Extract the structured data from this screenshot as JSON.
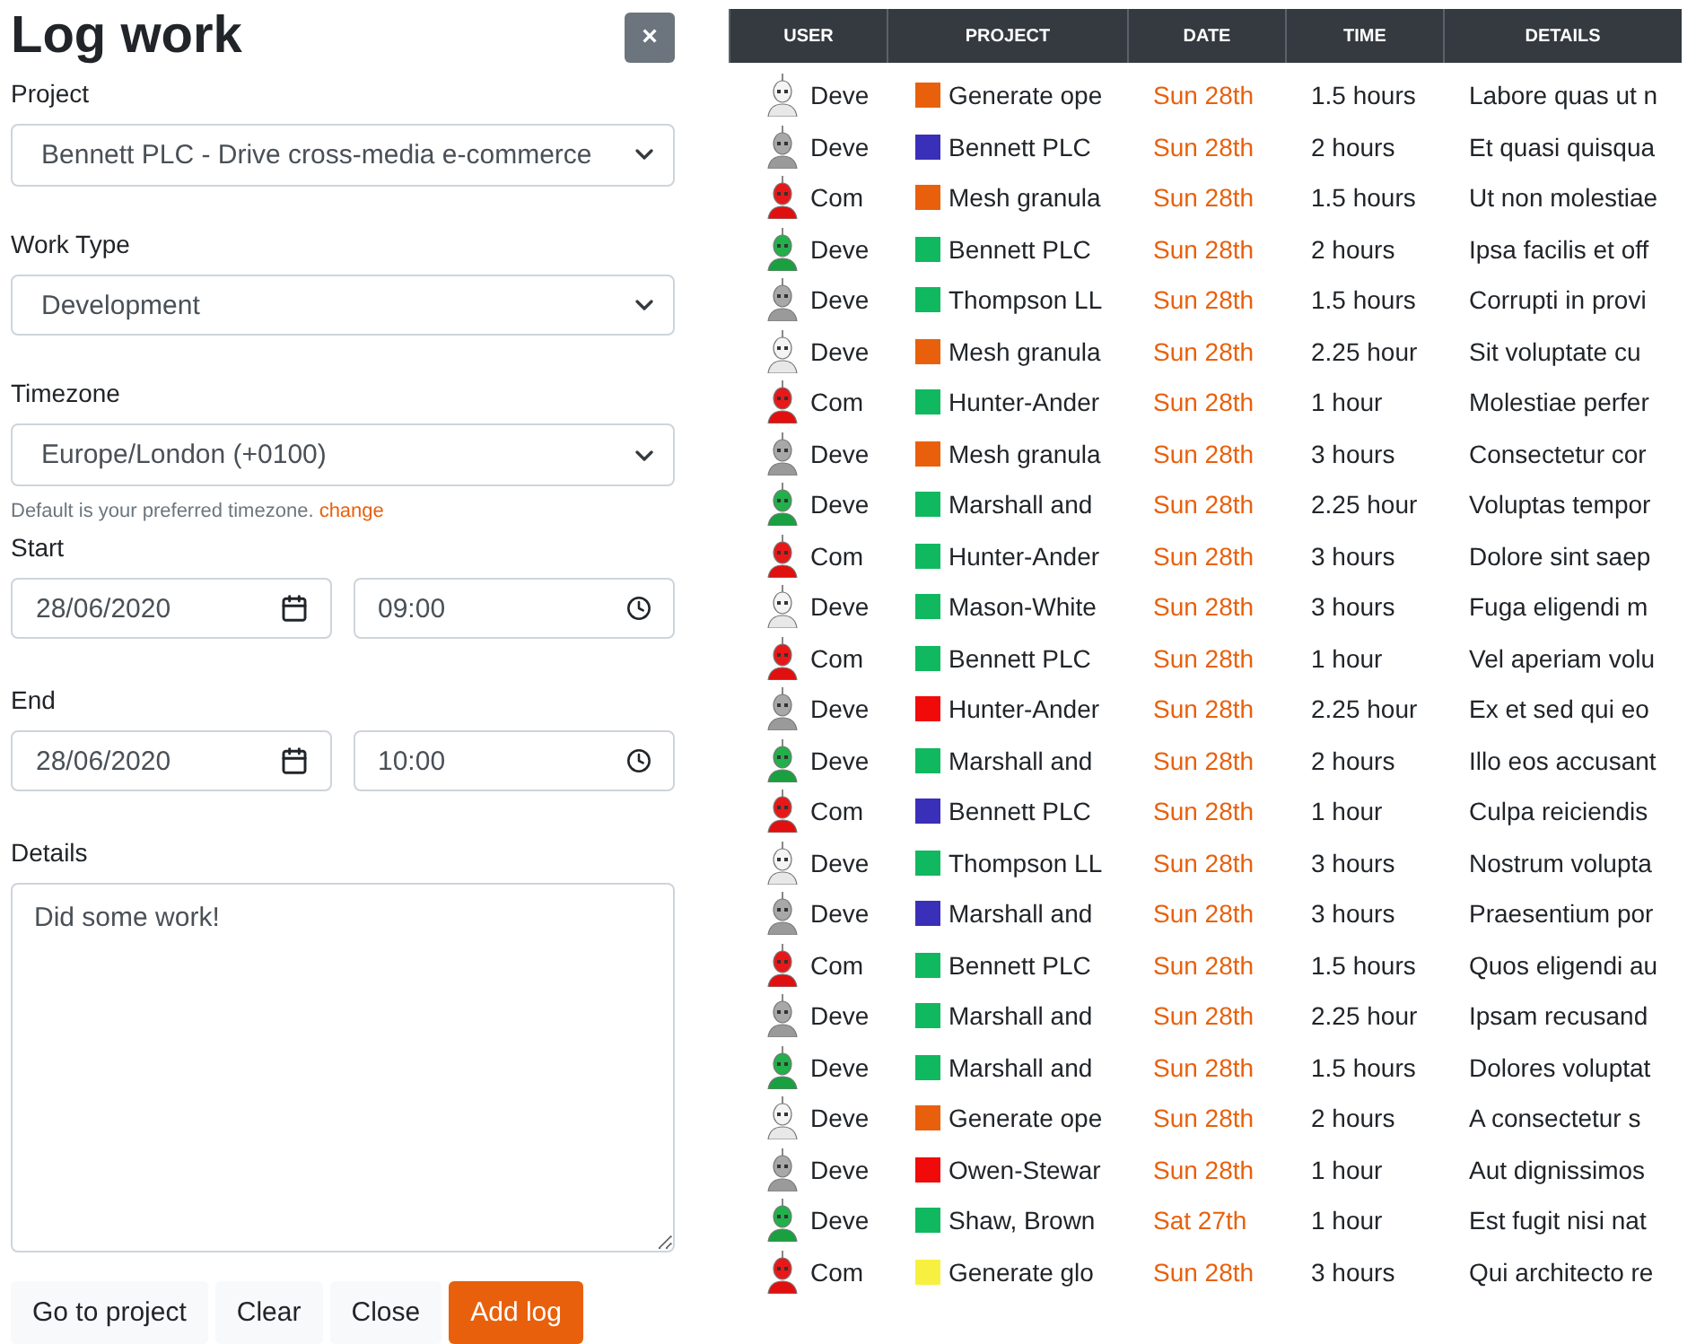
{
  "form": {
    "title": "Log work",
    "close_button": "×",
    "fields": [
      {
        "label": "Project",
        "value": "Bennett PLC - Drive cross-media e-commerce"
      },
      {
        "label": "Work Type",
        "value": "Development"
      },
      {
        "label": "Timezone",
        "value": "Europe/London (+0100)"
      }
    ],
    "timezone_help": {
      "text": "Default is your preferred timezone.",
      "link": "change"
    },
    "start": {
      "label": "Start",
      "date": "28/06/2020",
      "time": "09:00"
    },
    "end": {
      "label": "End",
      "date": "28/06/2020",
      "time": "10:00"
    },
    "details": {
      "label": "Details",
      "value": "Did some work!"
    },
    "buttons": [
      {
        "label": "Go to project",
        "kind": "secondary"
      },
      {
        "label": "Clear",
        "kind": "secondary"
      },
      {
        "label": "Close",
        "kind": "secondary"
      },
      {
        "label": "Add log",
        "kind": "primary"
      }
    ]
  },
  "table": {
    "columns": [
      "USER",
      "PROJECT",
      "DATE",
      "TIME",
      "DETAILS"
    ],
    "rows": [
      {
        "kind": "skeleton",
        "user": "Deve",
        "project": "Generate ope",
        "color": "#e8600c",
        "date": "Sun 28th",
        "time": "1.5 hours",
        "details": "Labore quas ut n"
      },
      {
        "kind": "grey",
        "user": "Deve",
        "project": "Bennett PLC",
        "color": "#3a2fb8",
        "date": "Sun 28th",
        "time": "2 hours",
        "details": "Et quasi quisqua"
      },
      {
        "kind": "red",
        "user": "Com",
        "project": "Mesh granula",
        "color": "#e8600c",
        "date": "Sun 28th",
        "time": "1.5 hours",
        "details": "Ut non molestiae"
      },
      {
        "kind": "green",
        "user": "Deve",
        "project": "Bennett PLC",
        "color": "#10b860",
        "date": "Sun 28th",
        "time": "2 hours",
        "details": "Ipsa facilis et off"
      },
      {
        "kind": "grey",
        "user": "Deve",
        "project": "Thompson LL",
        "color": "#10b860",
        "date": "Sun 28th",
        "time": "1.5 hours",
        "details": "Corrupti in provi"
      },
      {
        "kind": "skeleton",
        "user": "Deve",
        "project": "Mesh granula",
        "color": "#e8600c",
        "date": "Sun 28th",
        "time": "2.25 hour",
        "details": "Sit voluptate cu"
      },
      {
        "kind": "red",
        "user": "Com",
        "project": "Hunter-Ander",
        "color": "#10b860",
        "date": "Sun 28th",
        "time": "1 hour",
        "details": "Molestiae perfer"
      },
      {
        "kind": "grey",
        "user": "Deve",
        "project": "Mesh granula",
        "color": "#e8600c",
        "date": "Sun 28th",
        "time": "3 hours",
        "details": "Consectetur cor"
      },
      {
        "kind": "green",
        "user": "Deve",
        "project": "Marshall and",
        "color": "#10b860",
        "date": "Sun 28th",
        "time": "2.25 hour",
        "details": "Voluptas tempor"
      },
      {
        "kind": "red",
        "user": "Com",
        "project": "Hunter-Ander",
        "color": "#10b860",
        "date": "Sun 28th",
        "time": "3 hours",
        "details": "Dolore sint saep"
      },
      {
        "kind": "skeleton",
        "user": "Deve",
        "project": "Mason-White",
        "color": "#10b860",
        "date": "Sun 28th",
        "time": "3 hours",
        "details": "Fuga eligendi m"
      },
      {
        "kind": "red",
        "user": "Com",
        "project": "Bennett PLC",
        "color": "#10b860",
        "date": "Sun 28th",
        "time": "1 hour",
        "details": "Vel aperiam volu"
      },
      {
        "kind": "grey",
        "user": "Deve",
        "project": "Hunter-Ander",
        "color": "#f00a0a",
        "date": "Sun 28th",
        "time": "2.25 hour",
        "details": "Ex et sed qui eo"
      },
      {
        "kind": "green",
        "user": "Deve",
        "project": "Marshall and",
        "color": "#10b860",
        "date": "Sun 28th",
        "time": "2 hours",
        "details": "Illo eos accusant"
      },
      {
        "kind": "red",
        "user": "Com",
        "project": "Bennett PLC",
        "color": "#3a2fb8",
        "date": "Sun 28th",
        "time": "1 hour",
        "details": "Culpa reiciendis"
      },
      {
        "kind": "skeleton",
        "user": "Deve",
        "project": "Thompson LL",
        "color": "#10b860",
        "date": "Sun 28th",
        "time": "3 hours",
        "details": "Nostrum volupta"
      },
      {
        "kind": "grey",
        "user": "Deve",
        "project": "Marshall and",
        "color": "#3a2fb8",
        "date": "Sun 28th",
        "time": "3 hours",
        "details": "Praesentium por"
      },
      {
        "kind": "red",
        "user": "Com",
        "project": "Bennett PLC",
        "color": "#10b860",
        "date": "Sun 28th",
        "time": "1.5 hours",
        "details": "Quos eligendi au"
      },
      {
        "kind": "grey",
        "user": "Deve",
        "project": "Marshall and",
        "color": "#10b860",
        "date": "Sun 28th",
        "time": "2.25 hour",
        "details": "Ipsam recusand"
      },
      {
        "kind": "green",
        "user": "Deve",
        "project": "Marshall and",
        "color": "#10b860",
        "date": "Sun 28th",
        "time": "1.5 hours",
        "details": "Dolores voluptat"
      },
      {
        "kind": "skeleton",
        "user": "Deve",
        "project": "Generate ope",
        "color": "#e8600c",
        "date": "Sun 28th",
        "time": "2 hours",
        "details": "A consectetur s"
      },
      {
        "kind": "grey",
        "user": "Deve",
        "project": "Owen-Stewar",
        "color": "#f00a0a",
        "date": "Sun 28th",
        "time": "1 hour",
        "details": "Aut dignissimos"
      },
      {
        "kind": "green",
        "user": "Deve",
        "project": "Shaw, Brown",
        "color": "#10b860",
        "date": "Sat 27th",
        "time": "1 hour",
        "details": "Est fugit nisi nat"
      },
      {
        "kind": "red",
        "user": "Com",
        "project": "Generate glo",
        "color": "#f8f040",
        "date": "Sun 28th",
        "time": "3 hours",
        "details": "Qui architecto re"
      }
    ]
  }
}
